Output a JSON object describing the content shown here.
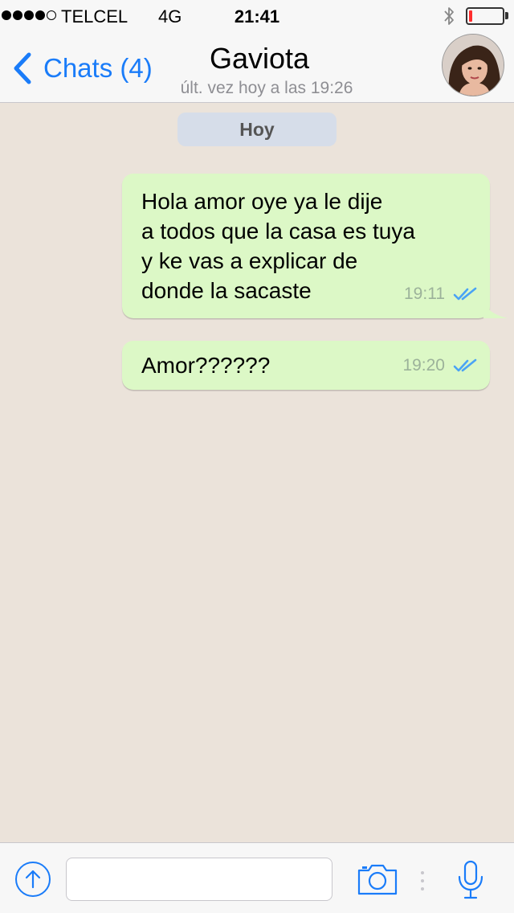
{
  "status_bar": {
    "carrier": "TELCEL",
    "network": "4G",
    "time": "21:41",
    "signal_bars_filled": 4,
    "signal_bars_total": 5,
    "battery_level_fraction": 0.1,
    "battery_color": "#ff2d2d"
  },
  "nav": {
    "back_label": "Chats (4)",
    "contact_name": "Gaviota",
    "last_seen": "últ. vez hoy a las 19:26",
    "accent_color": "#1a7cf9"
  },
  "chat": {
    "date_label": "Hoy",
    "messages": [
      {
        "text": "Hola amor oye ya le dije\na todos que la casa es tuya\ny ke vas a explicar de\ndonde la sacaste",
        "time": "19:11",
        "status": "double-check-icon"
      },
      {
        "text": "Amor??????",
        "time": "19:20",
        "status": "double-check-icon"
      }
    ],
    "outgoing_bubble_color": "#dcf8c6",
    "background_color": "#ebe3da"
  },
  "input_bar": {
    "placeholder": "",
    "upload_icon": "upload-arrow-icon",
    "camera_icon": "camera-icon",
    "mic_icon": "microphone-icon"
  }
}
